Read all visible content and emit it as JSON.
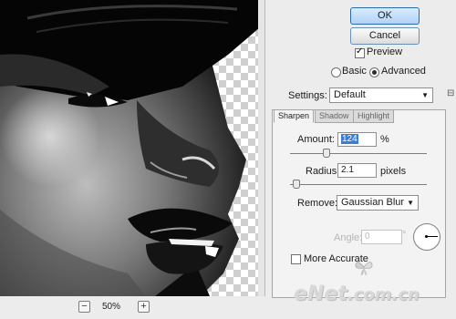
{
  "buttons": {
    "ok": "OK",
    "cancel": "Cancel"
  },
  "preview": {
    "label": "Preview",
    "checked": true
  },
  "mode": {
    "basic": "Basic",
    "advanced": "Advanced",
    "selected": "Advanced"
  },
  "settings": {
    "label": "Settings:",
    "value": "Default"
  },
  "tabs": [
    "Sharpen",
    "Shadow",
    "Highlight"
  ],
  "amount": {
    "label": "Amount:",
    "value": "124",
    "unit": "%",
    "level_fraction": 0.26
  },
  "radius": {
    "label": "Radius:",
    "value": "2.1",
    "unit": "pixels",
    "level_fraction": 0.04
  },
  "remove": {
    "label": "Remove:",
    "value": "Gaussian Blur"
  },
  "angle": {
    "label": "Angle:",
    "value": "0",
    "unit": "°"
  },
  "more_accurate": {
    "label": "More Accurate",
    "checked": false
  },
  "zoom": {
    "value": "50%",
    "minus": "−",
    "plus": "+"
  },
  "watermark": {
    "text": "eNet",
    "ext": ".com.cn"
  },
  "icons": {
    "settings_menu": "panel-menu-icon",
    "dropdown": "chevron-down-icon"
  }
}
